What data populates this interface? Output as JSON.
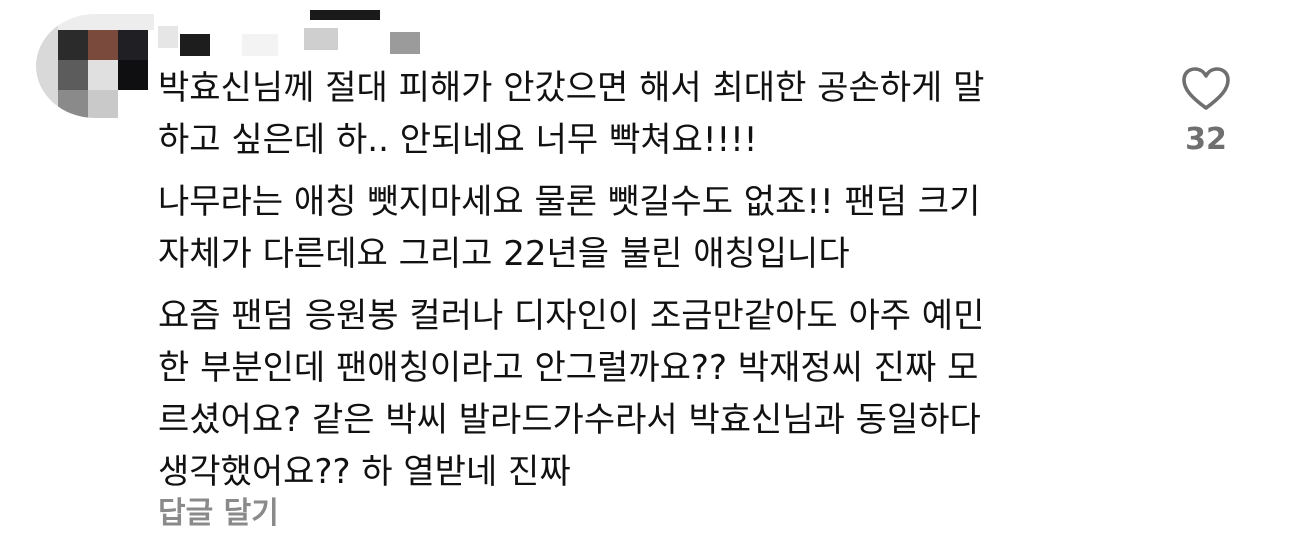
{
  "comment": {
    "username": "",
    "paragraphs": [
      [
        "박효신님께 절대 피해가 안갔으면 해서 최대한 공손하게 말",
        "하고 싶은데 하.. 안되네요 너무 빡쳐요!!!!"
      ],
      [
        "나무라는 애칭 뺏지마세요 물론 뺏길수도 없죠!! 팬덤 크기",
        "자체가 다른데요 그리고 22년을 불린 애칭입니다"
      ],
      [
        "요즘 팬덤 응원봉 컬러나 디자인이 조금만같아도 아주 예민",
        "한 부분인데 팬애칭이라고 안그럴까요?? 박재정씨 진짜 모",
        "르셨어요? 같은 박씨 발라드가수라서 박효신님과 동일하다",
        "생각했어요?? 하 열받네 진짜"
      ]
    ],
    "like_count": "32",
    "like_icon": "heart-outline-icon",
    "reply_label": "답글 달기"
  },
  "colors": {
    "text": "#111111",
    "muted": "#8a8a8a",
    "icon": "#6f6f6f"
  }
}
